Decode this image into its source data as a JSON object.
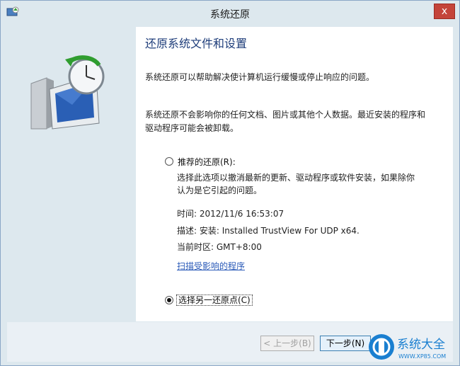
{
  "window": {
    "title": "系统还原",
    "close_glyph": "x"
  },
  "page": {
    "heading": "还原系统文件和设置",
    "intro": "系统还原可以帮助解决使计算机运行缓慢或停止响应的问题。",
    "note_line1": "系统还原不会影响你的任何文档、图片或其他个人数据。最近安装的程序和",
    "note_line2": "驱动程序可能会被卸载。"
  },
  "options": {
    "recommended": {
      "label": "推荐的还原(R):",
      "selected": false,
      "desc_line1": "选择此选项以撤消最新的更新、驱动程序或软件安装，如果除你",
      "desc_line2": "认为是它引起的问题。",
      "time": "时间: 2012/11/6 16:53:07",
      "description": "描述: 安装: Installed TrustView For UDP x64.",
      "timezone": "当前时区: GMT+8:00",
      "scan_link": "扫描受影响的程序"
    },
    "other": {
      "label": "选择另一还原点(C)",
      "selected": true
    }
  },
  "buttons": {
    "back": "< 上一步(B)",
    "next": "下一步(N)"
  },
  "watermark": {
    "text": "系统大全",
    "url": "WWW.XP85.COM"
  },
  "colors": {
    "heading": "#1e3d7a",
    "link": "#2a5ab8",
    "frame": "#dde8ee",
    "close": "#c4443a"
  }
}
